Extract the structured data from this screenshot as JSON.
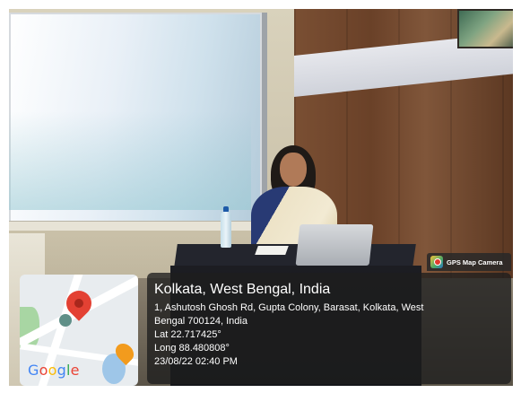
{
  "overlay": {
    "app_badge": "GPS Map Camera",
    "location_title": "Kolkata, West Bengal, India",
    "address_line_1": "1, Ashutosh Ghosh Rd, Gupta Colony, Barasat, Kolkata, West",
    "address_line_2": "Bengal 700124, India",
    "latitude": "Lat 22.717425°",
    "longitude": "Long 88.480808°",
    "timestamp": "23/08/22 02:40 PM"
  },
  "map": {
    "logo_letters": [
      "G",
      "o",
      "o",
      "g",
      "l",
      "e"
    ],
    "pin_icon": "location-pin-icon",
    "poi_icon": "restaurant-icon"
  },
  "colors": {
    "pin": "#e34133",
    "panel_bg": "rgba(30,30,30,0.78)",
    "google_blue": "#4285f4",
    "google_red": "#ea4335",
    "google_yellow": "#fbbc05",
    "google_green": "#34a853"
  }
}
